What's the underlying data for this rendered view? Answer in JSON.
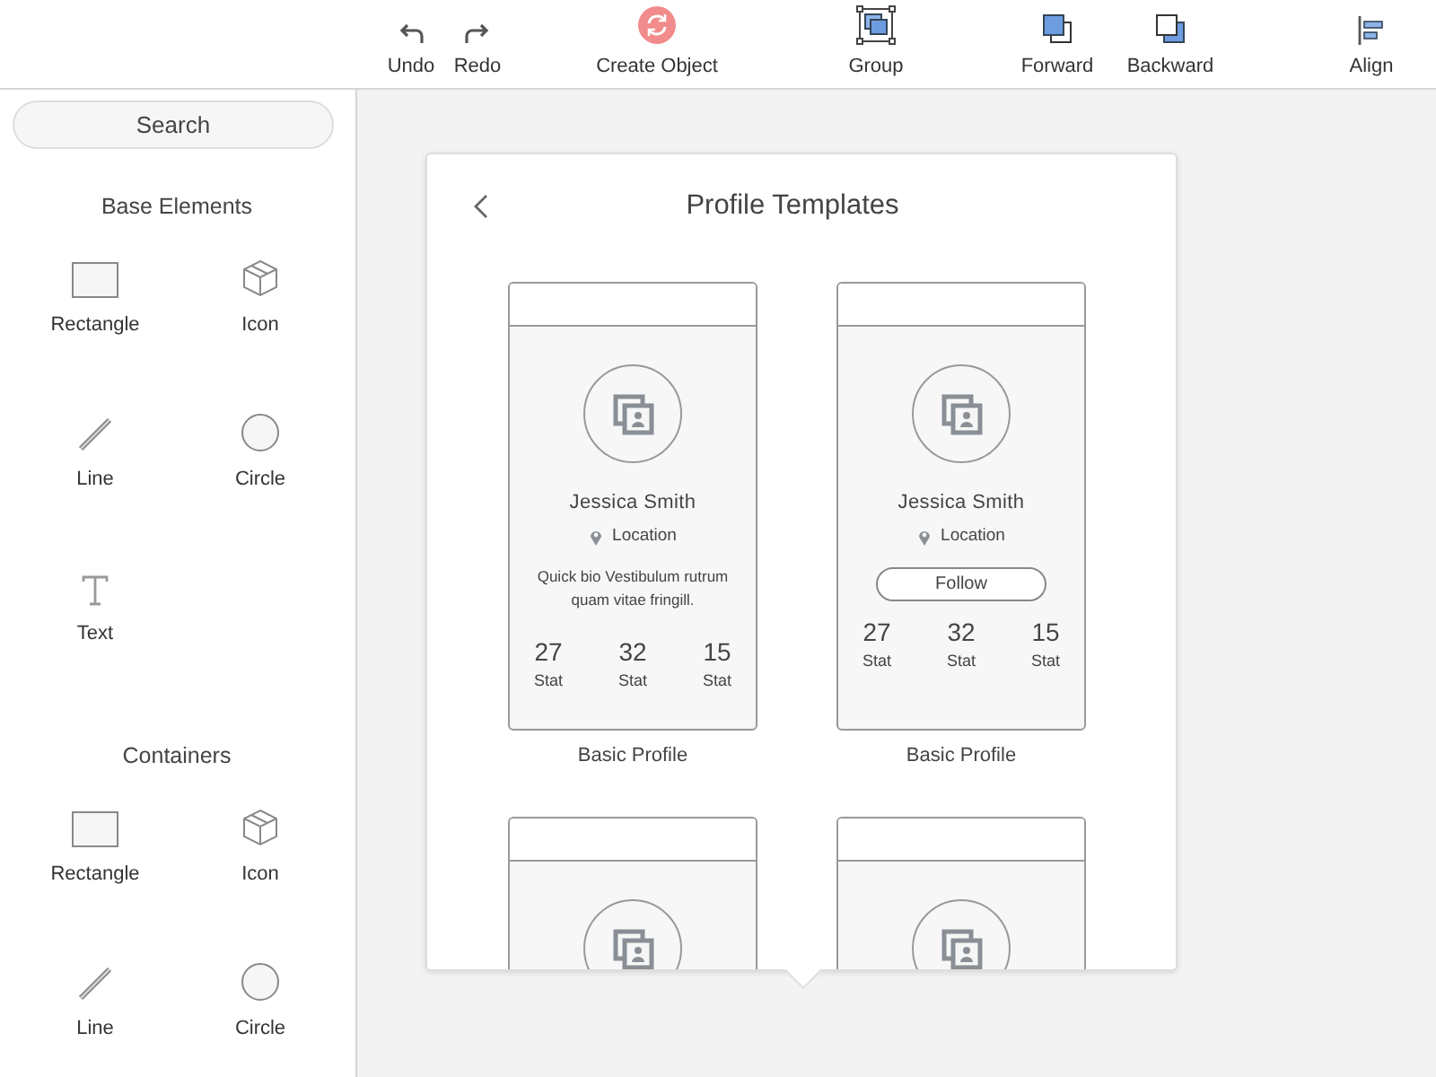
{
  "toolbar": [
    {
      "label": "Undo",
      "kind": "undo"
    },
    {
      "label": "Redo",
      "kind": "redo"
    },
    {
      "label": "Create Object",
      "kind": "create"
    },
    {
      "label": "Group",
      "kind": "group"
    },
    {
      "label": "Forward",
      "kind": "forward"
    },
    {
      "label": "Backward",
      "kind": "backward"
    },
    {
      "label": "Align",
      "kind": "align"
    }
  ],
  "sidebar": {
    "search": {
      "placeholder": "Search"
    },
    "sections": [
      {
        "title": "Base Elements",
        "items": [
          {
            "label": "Rectangle",
            "kind": "rectangle"
          },
          {
            "label": "Icon",
            "kind": "icon"
          },
          {
            "label": "Line",
            "kind": "line"
          },
          {
            "label": "Circle",
            "kind": "circle"
          },
          {
            "label": "Text",
            "kind": "text"
          }
        ]
      },
      {
        "title": "Containers",
        "items": [
          {
            "label": "Rectangle",
            "kind": "rectangle"
          },
          {
            "label": "Icon",
            "kind": "icon"
          },
          {
            "label": "Line",
            "kind": "line"
          },
          {
            "label": "Circle",
            "kind": "circle"
          }
        ]
      }
    ]
  },
  "popover": {
    "title": "Profile Templates",
    "templates": [
      {
        "kind": "bio",
        "name": "Jessica Smith",
        "location": "Location",
        "bio": "Quick bio Vestibulum rutrum quam vitae fringill.",
        "stats": [
          {
            "value": "27",
            "label": "Stat"
          },
          {
            "value": "32",
            "label": "Stat"
          },
          {
            "value": "15",
            "label": "Stat"
          }
        ],
        "caption": "Basic Profile"
      },
      {
        "kind": "follow",
        "name": "Jessica Smith",
        "location": "Location",
        "button": "Follow",
        "stats": [
          {
            "value": "27",
            "label": "Stat"
          },
          {
            "value": "32",
            "label": "Stat"
          },
          {
            "value": "15",
            "label": "Stat"
          }
        ],
        "caption": "Basic Profile"
      },
      {
        "kind": "partial"
      },
      {
        "kind": "partial"
      }
    ]
  }
}
